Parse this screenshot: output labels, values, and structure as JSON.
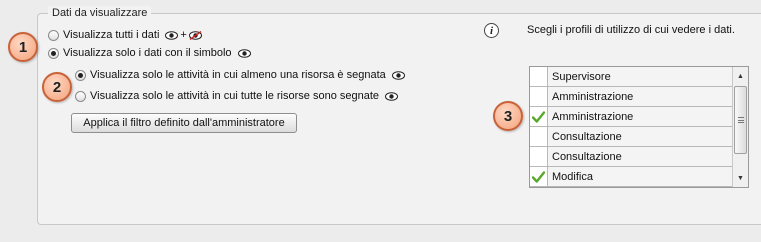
{
  "section": {
    "legend": "Dati da visualizzare"
  },
  "view_mode": {
    "option_all": "Visualizza tutti i dati",
    "option_symbol": "Visualizza solo i dati con il simbolo",
    "plus": "+",
    "selected": "option_symbol"
  },
  "activity_filter": {
    "option_any": "Visualizza solo le attività in cui almeno una risorsa è segnata",
    "option_all": "Visualizza solo le attività in cui tutte le risorse sono segnate",
    "selected": "option_any"
  },
  "admin_filter_button": "Applica il filtro definito dall'amministratore",
  "profiles": {
    "hint": "Scegli i profili di utilizzo di cui vedere i dati.",
    "info_glyph": "i",
    "items": [
      {
        "label": "Supervisore",
        "checked": false
      },
      {
        "label": "Amministrazione",
        "checked": false
      },
      {
        "label": "Amministrazione",
        "checked": true
      },
      {
        "label": "Consultazione",
        "checked": false
      },
      {
        "label": "Consultazione",
        "checked": false
      },
      {
        "label": "Modifica",
        "checked": true
      }
    ]
  },
  "markers": [
    "1",
    "2",
    "3"
  ],
  "colors": {
    "marker_fill": "#f3a27b",
    "marker_border": "#c8623a",
    "check": "#5aa82a",
    "eye_crossed": "#d02020"
  }
}
